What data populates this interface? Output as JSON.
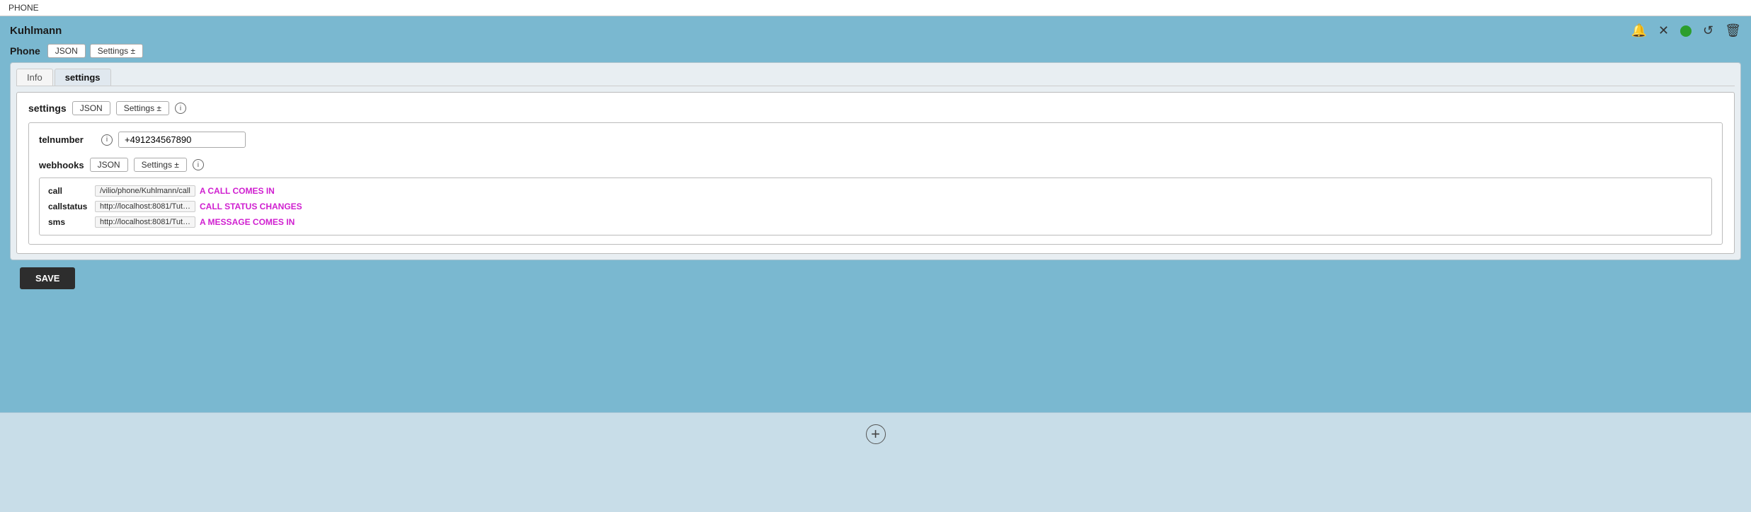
{
  "topbar": {
    "label": "PHONE"
  },
  "panel": {
    "title": "Kuhlmann",
    "tabs": [
      {
        "label": "Phone"
      },
      {
        "label": "JSON"
      },
      {
        "label": "Settings ±"
      }
    ],
    "icons": {
      "refresh": "↻",
      "bell": "🔔",
      "cross": "✕",
      "status_dot": "green",
      "reload": "↺",
      "trash": "🗑"
    }
  },
  "inner_tabs": [
    {
      "label": "Info",
      "active": false
    },
    {
      "label": "settings",
      "active": true
    }
  ],
  "settings_section": {
    "title": "settings",
    "json_btn": "JSON",
    "settings_btn": "Settings ±",
    "telnumber": {
      "label": "telnumber",
      "value": "+491234567890"
    },
    "webhooks": {
      "label": "webhooks",
      "json_btn": "JSON",
      "settings_btn": "Settings ±",
      "rows": [
        {
          "key": "call",
          "url": "/vilio/phone/Kuhlmann/call",
          "event": "A CALL COMES IN"
        },
        {
          "key": "callstatus",
          "url": "http://localhost:8081/Tut…",
          "event": "CALL STATUS CHANGES"
        },
        {
          "key": "sms",
          "url": "http://localhost:8081/Tut…",
          "event": "A MESSAGE COMES IN"
        }
      ]
    }
  },
  "save_btn_label": "SAVE",
  "add_icon_title": "Add"
}
